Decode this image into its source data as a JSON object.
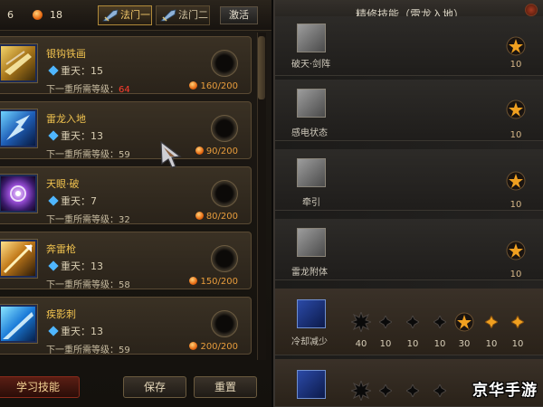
{
  "topbar": {
    "count_a": "6",
    "count_b": "18",
    "tabs": [
      {
        "label": "法门一",
        "active": true
      },
      {
        "label": "法门二",
        "active": false
      }
    ],
    "activate_label": "激活"
  },
  "skills": [
    {
      "name": "银钩铁画",
      "level": "重天：15",
      "req_label": "下一重所需等级：",
      "req_value": "64",
      "req_red": true,
      "cost": "160/200"
    },
    {
      "name": "雷龙入地",
      "level": "重天：13",
      "req_label": "下一重所需等级：",
      "req_value": "59",
      "req_red": false,
      "cost": "90/200"
    },
    {
      "name": "天眼·破",
      "level": "重天：7",
      "req_label": "下一重所需等级：",
      "req_value": "32",
      "req_red": false,
      "cost": "80/200"
    },
    {
      "name": "奔雷枪",
      "level": "重天：13",
      "req_label": "下一重所需等级：",
      "req_value": "58",
      "req_red": false,
      "cost": "150/200"
    },
    {
      "name": "疾影刺",
      "level": "重天：13",
      "req_label": "下一重所需等级：",
      "req_value": "59",
      "req_red": false,
      "cost": "200/200"
    }
  ],
  "bottom": {
    "learn_label": "学习技能",
    "save_label": "保存",
    "reset_label": "重置"
  },
  "panel": {
    "title": "精修技能（雷龙入地）",
    "rows": [
      {
        "name": "破天·剑阵",
        "star_value": "10"
      },
      {
        "name": "感电状态",
        "star_value": "10"
      },
      {
        "name": "牵引",
        "star_value": "10"
      },
      {
        "name": "雷龙附体",
        "star_value": "10"
      },
      {
        "name": "冷却减少",
        "nodes": [
          "40",
          "10",
          "10",
          "10",
          "30",
          "10",
          "10"
        ]
      }
    ]
  },
  "watermark": "京华手游",
  "colors": {
    "gold_text": "#f0c24f",
    "red_text": "#ff3d2e",
    "orange_text": "#e79c3c",
    "blue_gem": "#4fb6ff"
  }
}
